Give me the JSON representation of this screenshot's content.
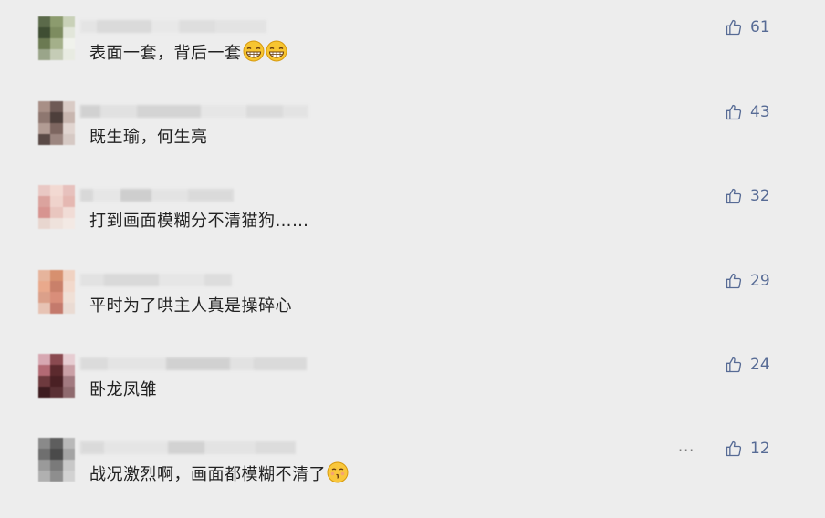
{
  "comments": [
    {
      "text": "表面一套，背后一套",
      "emojis": [
        "grin-emoji",
        "grin-emoji"
      ],
      "likes": "61",
      "avatar_colors": [
        "#5b6a4a",
        "#8c9b6e",
        "#c9d1b8",
        "#3f4e33",
        "#7d8c60",
        "#e2e6da",
        "#6b7a52",
        "#a4b08a",
        "#f0f2ec",
        "#9aa58a",
        "#c5ccb6",
        "#e8ebe2"
      ],
      "name_colors": [
        "#e4e4e4",
        "#d8d8d8",
        "#e8e8e8",
        "#dddddd",
        "#e2e2e2"
      ]
    },
    {
      "text": "既生瑜，何生亮",
      "emojis": [],
      "likes": "43",
      "avatar_colors": [
        "#a88f86",
        "#6e5a55",
        "#d9cbc5",
        "#8e7770",
        "#4d3f3b",
        "#c8b6af",
        "#b29c94",
        "#7d6660",
        "#e1d5d0",
        "#5a4a46",
        "#9c8680",
        "#d6c9c4"
      ],
      "name_colors": [
        "#cfcfcf",
        "#e0e0e0",
        "#d2d2d2",
        "#e6e6e6",
        "#dadada",
        "#e3e3e3"
      ]
    },
    {
      "text": "打到画面模糊分不清猫狗……",
      "emojis": [],
      "likes": "32",
      "avatar_colors": [
        "#e9c8c4",
        "#f2d9d2",
        "#e7c1bd",
        "#dba39e",
        "#efd3cc",
        "#e5b8b2",
        "#d79490",
        "#e9c6bf",
        "#f1dcd6",
        "#e8d6cf",
        "#efe2dc",
        "#f3e9e4"
      ],
      "name_colors": [
        "#d6d6d6",
        "#e6e6e6",
        "#cbcbcb",
        "#e3e3e3",
        "#d9d9d9"
      ]
    },
    {
      "text": "平时为了哄主人真是操碎心",
      "emojis": [],
      "likes": "29",
      "avatar_colors": [
        "#e6b49c",
        "#d7906f",
        "#f0d2c2",
        "#e9a98c",
        "#c9806a",
        "#f2d9cc",
        "#dba08a",
        "#d98e7a",
        "#f0e0d6",
        "#e7c3b4",
        "#c47a6c",
        "#eadbd3"
      ],
      "name_colors": [
        "#e1e1e1",
        "#d7d7d7",
        "#e6e6e6",
        "#dcdcdc"
      ]
    },
    {
      "text": "卧龙凤雏",
      "emojis": [],
      "likes": "24",
      "avatar_colors": [
        "#d7a8b2",
        "#8a4a50",
        "#e7cdd2",
        "#b36a74",
        "#5c2a2e",
        "#caa0a6",
        "#6e3a3e",
        "#4a2024",
        "#a27a80",
        "#3e1c20",
        "#5a3034",
        "#8f6a6e"
      ],
      "name_colors": [
        "#dadada",
        "#e4e4e4",
        "#cfcfcf",
        "#e1e1e1",
        "#d8d8d8"
      ]
    },
    {
      "text": "战况激烈啊，画面都模糊不清了",
      "emojis": [
        "kiss-emoji"
      ],
      "likes": "12",
      "avatar_colors": [
        "#8a8a8a",
        "#5e5e5e",
        "#b9b9b9",
        "#6f6f6f",
        "#4a4a4a",
        "#a4a4a4",
        "#9a9a9a",
        "#7a7a7a",
        "#c8c8c8",
        "#b0b0b0",
        "#8e8e8e",
        "#d2d2d2"
      ],
      "name_colors": [
        "#d9d9d9",
        "#e5e5e5",
        "#d0d0d0",
        "#e2e2e2",
        "#dbdbdb"
      ],
      "more": "···"
    }
  ]
}
